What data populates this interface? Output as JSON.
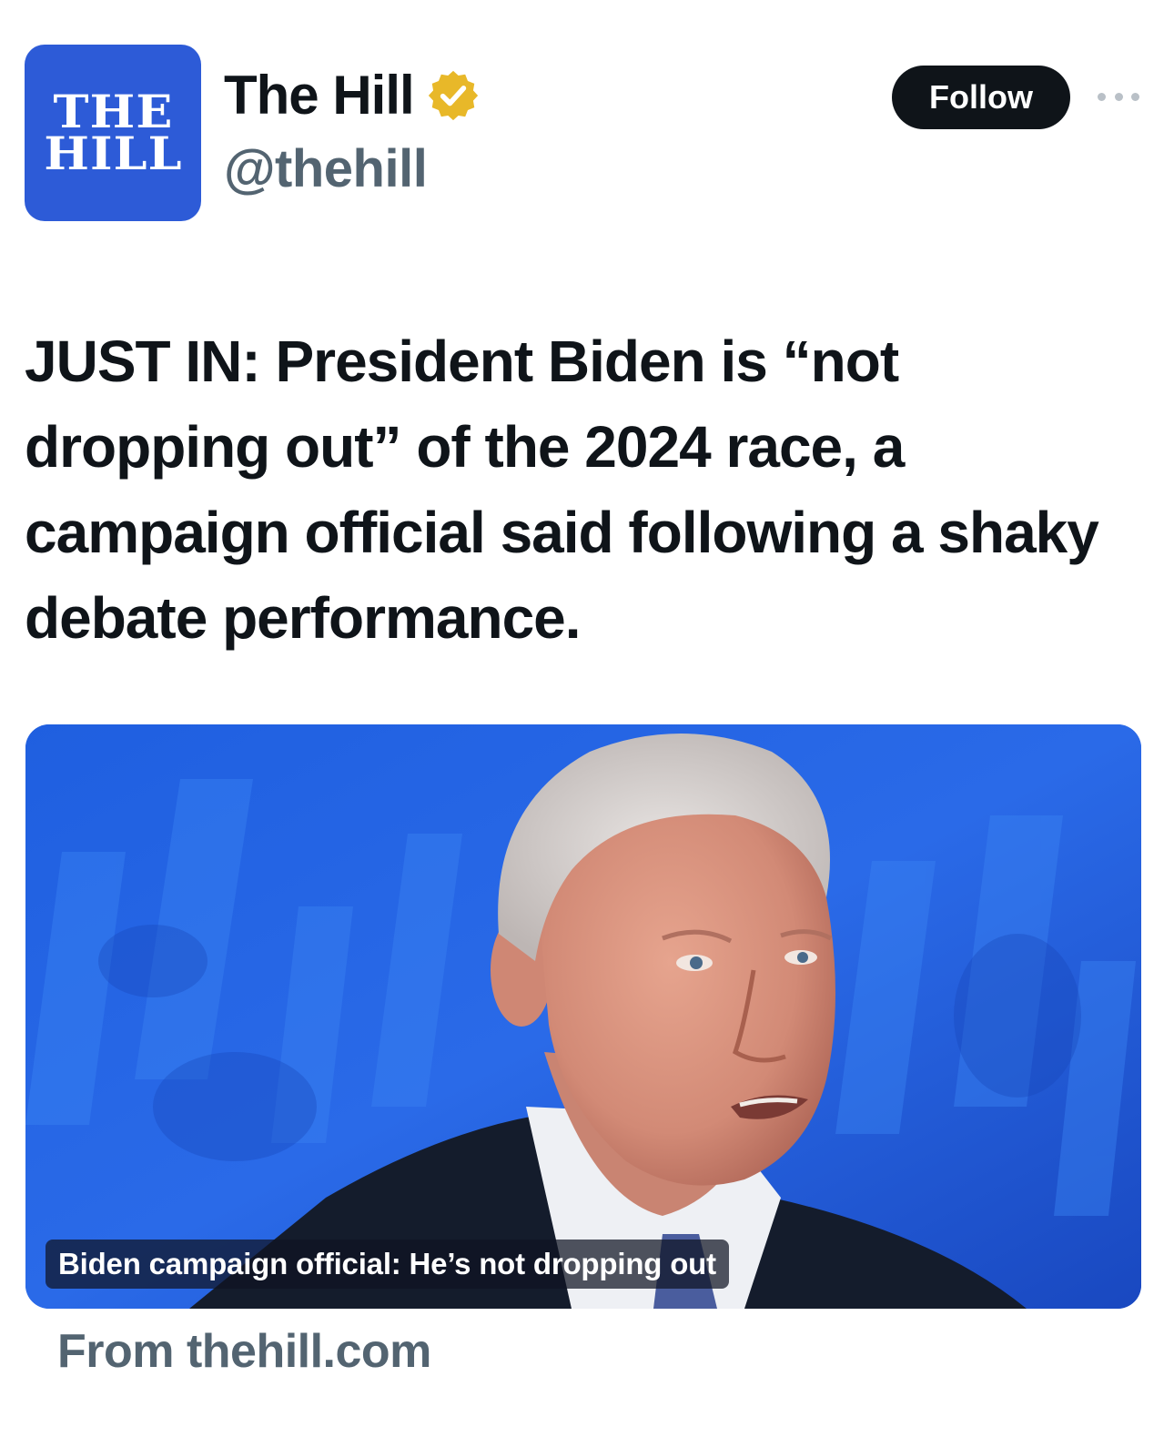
{
  "profile": {
    "avatar_text_line1": "THE",
    "avatar_text_line2": "HILL",
    "display_name": "The Hill",
    "handle": "@thehill",
    "verified_icon": "verified-badge-icon",
    "brand_color": "#2d5bd7",
    "badge_color": "#e8b829"
  },
  "actions": {
    "follow_label": "Follow",
    "more_icon": "more-options-icon"
  },
  "tweet": {
    "text": "JUST IN: President Biden is “not dropping out” of the 2024 race, a campaign official said following a shaky debate performance."
  },
  "card": {
    "caption": "Biden campaign official: He’s not dropping out",
    "source": "From thehill.com"
  }
}
